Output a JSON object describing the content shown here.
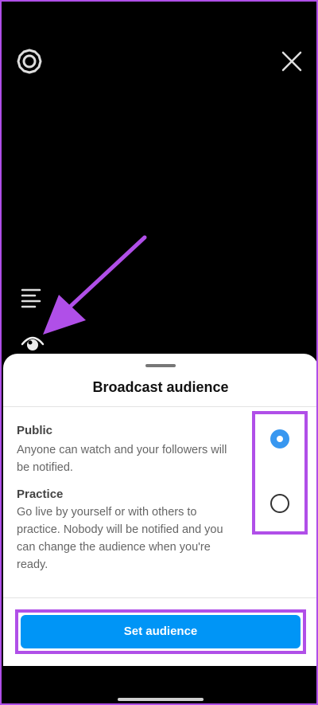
{
  "icons": {
    "settings": "gear-icon",
    "close": "close-icon",
    "menu": "lines-icon",
    "audience": "eye-icon"
  },
  "sheet": {
    "title": "Broadcast audience",
    "options": [
      {
        "title": "Public",
        "description": "Anyone can watch and your followers will be notified.",
        "selected": true
      },
      {
        "title": "Practice",
        "description": "Go live by yourself or with others to practice. Nobody will be notified and you can change the audience when you're ready.",
        "selected": false
      }
    ],
    "button_label": "Set audience"
  },
  "colors": {
    "accent": "#0095f6",
    "radio_selected": "#3897f0",
    "annotation": "#b04fe8"
  }
}
